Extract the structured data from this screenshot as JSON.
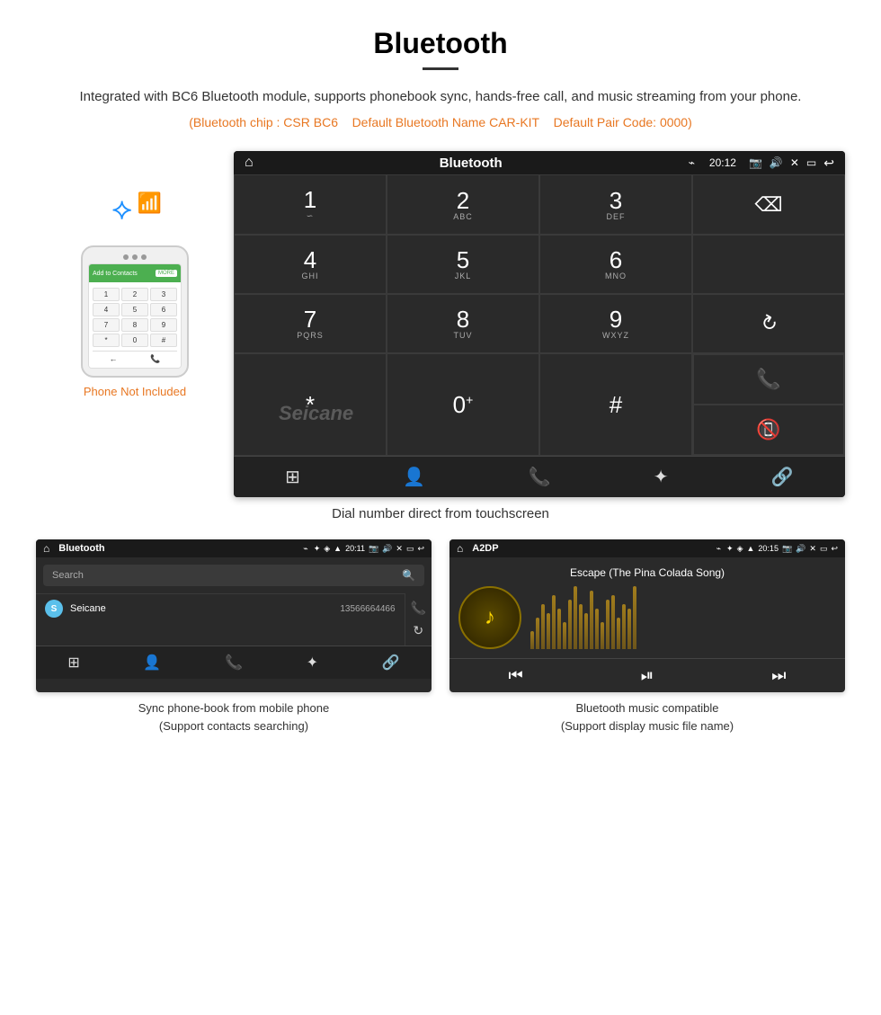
{
  "page": {
    "title": "Bluetooth",
    "divider": true,
    "description": "Integrated with BC6 Bluetooth module, supports phonebook sync, hands-free call, and music streaming from your phone.",
    "specs": "(Bluetooth chip : CSR BC6    Default Bluetooth Name CAR-KIT    Default Pair Code: 0000)",
    "phone_not_included": "Phone Not Included",
    "main_screen_caption": "Dial number direct from touchscreen",
    "bottom_left_caption_line1": "Sync phone-book from mobile phone",
    "bottom_left_caption_line2": "(Support contacts searching)",
    "bottom_right_caption_line1": "Bluetooth music compatible",
    "bottom_right_caption_line2": "(Support display music file name)"
  },
  "main_screen": {
    "statusbar": {
      "home_icon": "⌂",
      "title": "Bluetooth",
      "usb_icon": "⌁",
      "bt_icon": "✦",
      "location_icon": "◈",
      "signal_icon": "▲",
      "time": "20:12",
      "camera_icon": "📷",
      "volume_icon": "◁",
      "close_icon": "✕",
      "window_icon": "▭",
      "back_icon": "↩"
    },
    "dialpad": {
      "keys": [
        {
          "num": "1",
          "sub": "∽",
          "col": 1,
          "row": 1
        },
        {
          "num": "2",
          "sub": "ABC",
          "col": 2,
          "row": 1
        },
        {
          "num": "3",
          "sub": "DEF",
          "col": 3,
          "row": 1
        },
        {
          "num": "",
          "sub": "",
          "col": 4,
          "row": 1,
          "type": "backspace"
        },
        {
          "num": "4",
          "sub": "GHI",
          "col": 1,
          "row": 2
        },
        {
          "num": "5",
          "sub": "JKL",
          "col": 2,
          "row": 2
        },
        {
          "num": "6",
          "sub": "MNO",
          "col": 3,
          "row": 2
        },
        {
          "num": "",
          "sub": "",
          "col": 4,
          "row": 2,
          "type": "empty"
        },
        {
          "num": "7",
          "sub": "PQRS",
          "col": 1,
          "row": 3
        },
        {
          "num": "8",
          "sub": "TUV",
          "col": 2,
          "row": 3
        },
        {
          "num": "9",
          "sub": "WXYZ",
          "col": 3,
          "row": 3
        },
        {
          "num": "",
          "sub": "",
          "col": 4,
          "row": 3,
          "type": "refresh"
        },
        {
          "num": "*",
          "sub": "",
          "col": 1,
          "row": 4
        },
        {
          "num": "0",
          "sub": "+",
          "col": 2,
          "row": 4
        },
        {
          "num": "#",
          "sub": "",
          "col": 3,
          "row": 4
        },
        {
          "num": "",
          "sub": "",
          "col": 4,
          "row": 4,
          "type": "call-green"
        },
        {
          "num": "",
          "sub": "",
          "col": 4,
          "row": 4,
          "type": "call-red"
        }
      ],
      "bottom_icons": [
        "⊞",
        "👤",
        "📞",
        "✦",
        "🔗"
      ]
    }
  },
  "phonebook_screen": {
    "statusbar_title": "Bluetooth",
    "search_placeholder": "Search",
    "contact_name": "Seicane",
    "contact_phone": "13566664466",
    "contact_initial": "S",
    "right_icons": [
      "📞",
      "↺"
    ],
    "bottom_icons": [
      "⊞",
      "👤",
      "📞",
      "✦",
      "🔗"
    ]
  },
  "music_screen": {
    "statusbar_title": "A2DP",
    "time": "20:15",
    "song_title": "Escape (The Pina Colada Song)",
    "note_icon": "♪",
    "controls": [
      "⏮",
      "⏭|",
      "⏭"
    ],
    "viz_bars": [
      20,
      35,
      50,
      40,
      60,
      45,
      30,
      55,
      70,
      50,
      40,
      65,
      45,
      30,
      55,
      60,
      35,
      50,
      45,
      70
    ]
  },
  "phone_mock": {
    "add_to_contacts": "Add to Contacts",
    "keys": [
      "1",
      "2",
      "3",
      "4",
      "5",
      "6",
      "7",
      "8",
      "9",
      "*",
      "0",
      "#"
    ]
  },
  "colors": {
    "orange": "#e87722",
    "green_call": "#4CAF50",
    "red_call": "#e05252",
    "blue_bt": "#1e90ff",
    "screen_bg": "#2a2a2a"
  }
}
